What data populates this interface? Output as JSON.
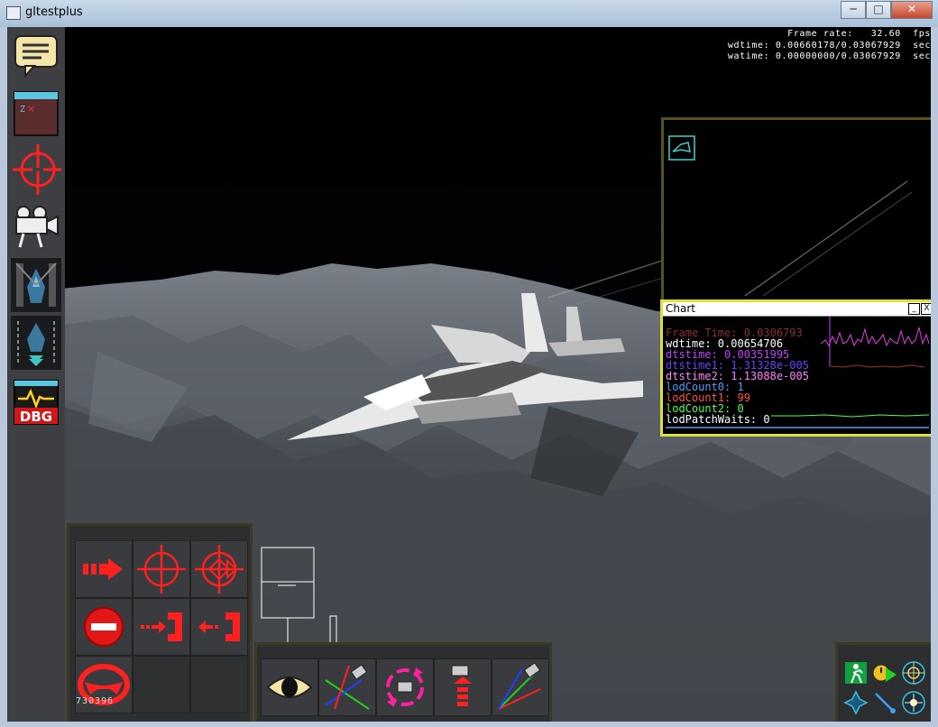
{
  "window": {
    "title": "gltestplus",
    "minimize": "─",
    "maximize": "□",
    "close": "✕"
  },
  "stats": {
    "frame_rate": "Frame rate:   32.60  fps",
    "wdtime": "wdtime: 0.00660178/0.03067929  sec",
    "watime": "watime: 0.00000000/0.03067929  sec"
  },
  "left_toolbar": [
    {
      "name": "chat-icon"
    },
    {
      "name": "window-icon"
    },
    {
      "name": "crosshair-icon"
    },
    {
      "name": "camera-icon"
    },
    {
      "name": "aircraft-select-icon"
    },
    {
      "name": "aircraft-deploy-icon"
    },
    {
      "name": "debug-icon",
      "label": "DBG"
    }
  ],
  "chart": {
    "title": "Chart",
    "min_button": "_",
    "close_button": "X",
    "lines": [
      {
        "text": "Frame Time: 0.0306793",
        "color": "#8a3030"
      },
      {
        "text": "wdtime: 0.00654706",
        "color": "#ffffff"
      },
      {
        "text": "dtstime: 0.00351995",
        "color": "#c040ff"
      },
      {
        "text": "dtstime1: 1.31328e-005",
        "color": "#6a40ff"
      },
      {
        "text": "dtstime2: 1.13088e-005",
        "color": "#ff80ff"
      },
      {
        "text": "lodCount0: 1",
        "color": "#4aa0ff"
      },
      {
        "text": "lodCount1: 99",
        "color": "#ff5050"
      },
      {
        "text": "lodCount2: 0",
        "color": "#50ff50"
      },
      {
        "text": "lodPatchWaits: 0",
        "color": "#ffffff"
      }
    ]
  },
  "counter": "730396",
  "bottom_left": [
    {
      "name": "move-forward-icon"
    },
    {
      "name": "target-icon"
    },
    {
      "name": "multi-target-icon"
    },
    {
      "name": "stop-icon"
    },
    {
      "name": "dock-in-icon"
    },
    {
      "name": "dock-out-icon"
    },
    {
      "name": "steering-wheel-icon"
    }
  ],
  "bottom_middle": [
    {
      "name": "eye-icon"
    },
    {
      "name": "camera-axis-icon"
    },
    {
      "name": "camera-rotate-icon"
    },
    {
      "name": "camera-up-icon"
    },
    {
      "name": "camera-move-icon"
    }
  ],
  "bottom_right": [
    {
      "name": "exit-icon"
    },
    {
      "name": "timer-play-icon"
    },
    {
      "name": "compass-icon"
    },
    {
      "name": "formation-icon"
    },
    {
      "name": "pointer-icon"
    },
    {
      "name": "sun-icon"
    }
  ],
  "colors": {
    "accent": "#e0e030",
    "tool_red": "#ff2020",
    "panel": "#2d2e30"
  }
}
